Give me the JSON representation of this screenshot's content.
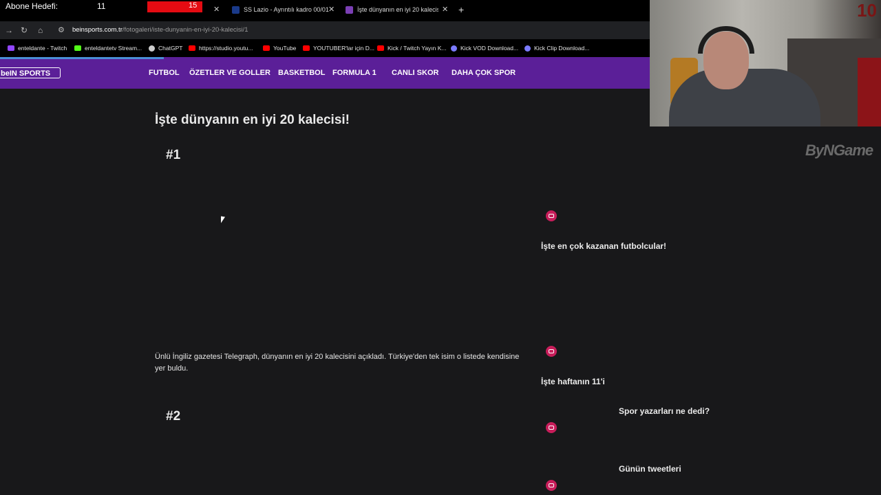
{
  "overlay": {
    "goal_label": "Abone Hedefi:",
    "goal_current": "11",
    "goal_target": "15"
  },
  "browser": {
    "tabs": [
      {
        "title": "SS Lazio - Ayrıntılı kadro 00/01"
      },
      {
        "title": "İşte dünyanın en iyi 20 kalecisi |"
      }
    ],
    "url_host": "beinsports.com.tr",
    "url_path": "/fotogaleri/iste-dunyanin-en-iyi-20-kalecisi/1",
    "bookmarks": [
      {
        "label": "enteldante - Twitch",
        "color": "#9146ff"
      },
      {
        "label": "enteldantetv Stream...",
        "color": "#53fc18"
      },
      {
        "label": "ChatGPT",
        "color": "#cccccc"
      },
      {
        "label": "https://studio.youtu...",
        "color": "#ff0000"
      },
      {
        "label": "YouTube",
        "color": "#ff0000"
      },
      {
        "label": "YOUTUBER'lar için D...",
        "color": "#ff0000"
      },
      {
        "label": "Kick / Twitch Yayın K...",
        "color": "#ff0000"
      },
      {
        "label": "Kick VOD Download...",
        "color": "#7b7bff"
      },
      {
        "label": "Kick Clip Download...",
        "color": "#7b7bff"
      }
    ]
  },
  "site": {
    "logo": "beIN SPORTS",
    "nav": [
      "FUTBOL",
      "ÖZETLER VE GOLLER",
      "BASKETBOL",
      "FORMULA 1",
      "CANLI SKOR",
      "DAHA ÇOK SPOR"
    ]
  },
  "article": {
    "title": "İşte dünyanın en iyi 20 kalecisi!",
    "item1": "#1",
    "description": "Ünlü İngiliz gazetesi Telegraph, dünyanın en iyi 20 kalecisini açıkladı. Türkiye'den tek isim o listede kendisine yer buldu.",
    "item2": "#2"
  },
  "sidebar": [
    "İşte en çok kazanan futbolcular!",
    "İşte haftanın 11'i",
    "Spor yazarları ne dedi?",
    "Günün tweetleri"
  ],
  "webcam": {
    "badge": "10"
  },
  "watermark": "ByNGame"
}
